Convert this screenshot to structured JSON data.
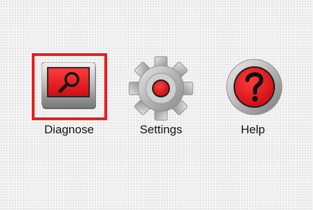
{
  "menu": {
    "items": [
      {
        "label": "Diagnose",
        "icon": "magnifier-icon",
        "selected": true
      },
      {
        "label": "Settings",
        "icon": "gear-icon",
        "selected": false
      },
      {
        "label": "Help",
        "icon": "question-mark-icon",
        "selected": false
      }
    ]
  },
  "colors": {
    "selection_frame": "#e41f1f",
    "icon_accent_red": "#e8141b",
    "icon_metal": "#b9b9b9",
    "background": "#f4f4f4",
    "label_text": "#111111"
  }
}
